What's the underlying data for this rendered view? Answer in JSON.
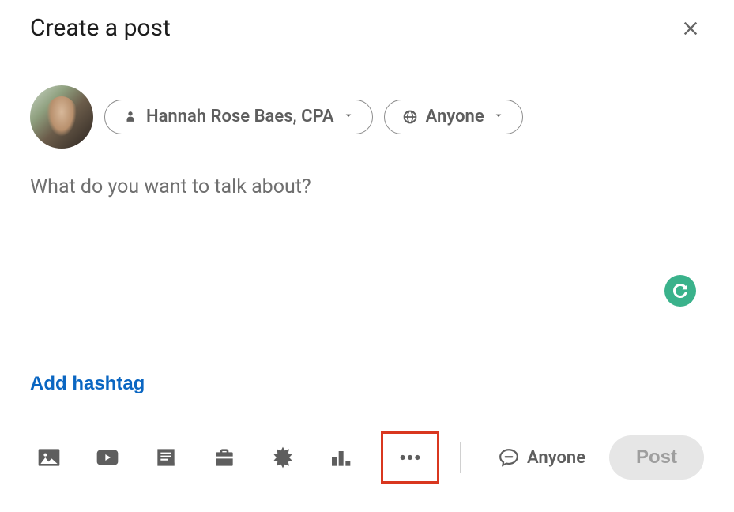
{
  "modal": {
    "title": "Create a post",
    "close_label": "Close"
  },
  "author": {
    "name": "Hannah Rose Baes, CPA",
    "visibility": "Anyone"
  },
  "composer": {
    "placeholder": "What do you want to talk about?"
  },
  "actions": {
    "add_hashtag": "Add hashtag"
  },
  "toolbar": {
    "icons": {
      "photo": "photo-icon",
      "video": "video-icon",
      "document": "document-icon",
      "job": "briefcase-icon",
      "celebrate": "starburst-icon",
      "poll": "poll-icon",
      "more": "more-icon"
    }
  },
  "comment_control": {
    "label": "Anyone"
  },
  "submit": {
    "label": "Post"
  }
}
